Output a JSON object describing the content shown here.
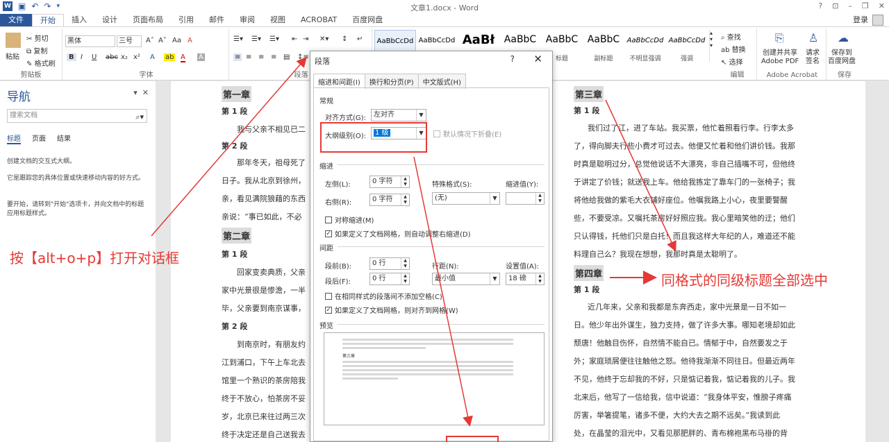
{
  "window": {
    "title": "文章1.docx - Word",
    "controls": [
      "?",
      "⊡",
      "–",
      "❐",
      "✕"
    ]
  },
  "tabs": [
    "文件",
    "开始",
    "插入",
    "设计",
    "页面布局",
    "引用",
    "邮件",
    "审阅",
    "视图",
    "ACROBAT",
    "百度网盘"
  ],
  "login": "登录",
  "ribbon": {
    "clipboard": {
      "paste": "粘贴",
      "cut": "剪切",
      "copy": "复制",
      "format_painter": "格式刷",
      "label": "剪贴板"
    },
    "font": {
      "name": "黑体",
      "size": "三号",
      "label": "字体",
      "bold": "B",
      "italic": "I",
      "underline": "U",
      "strike": "abc",
      "sub": "x₂",
      "sup": "x²",
      "grow": "A˄",
      "shrink": "A˅",
      "case": "Aa",
      "clear": "A"
    },
    "paragraph": {
      "label": "段落"
    },
    "styles": [
      {
        "sample": "AaBbCcDd",
        "name": ""
      },
      {
        "sample": "AaBbCcDd",
        "name": ""
      },
      {
        "sample": "AaBł",
        "name": ""
      },
      {
        "sample": "AaBbC",
        "name": "标题"
      },
      {
        "sample": "AaBbC",
        "name": "标题"
      },
      {
        "sample": "AaBbC",
        "name": "副标题"
      },
      {
        "sample": "AaBbCcDd",
        "name": "不明显强调"
      },
      {
        "sample": "AaBbCcDd",
        "name": "强调"
      }
    ],
    "editing": {
      "find": "查找",
      "replace": "替换",
      "select": "选择",
      "label": "编辑"
    },
    "acrobat": {
      "create_share": "创建并共享\nAdobe PDF",
      "request_sign": "请求\n签名",
      "label": "Adobe Acrobat"
    },
    "baidu": {
      "save": "保存到\n百度网盘",
      "label": "保存"
    }
  },
  "nav": {
    "title": "导航",
    "search_placeholder": "搜索文档",
    "tabs": [
      "标题",
      "页面",
      "结果"
    ],
    "text1": "创建文档的交互式大纲。",
    "text2": "它是跟踪您的具体位置或快速移动内容的好方式。",
    "text3": "要开始，请转到\"开始\"选项卡，并向文档中的标题应用标题样式。"
  },
  "doc_left": {
    "ch1": "第一章",
    "seg1": "第 1 段",
    "p1": "我与父亲不相见已二",
    "seg2": "第 2 段",
    "p2a": "那年冬天，祖母死了",
    "p2b": "日子。我从北京到徐州，",
    "p2c": "亲，看见满院狼藉的东西",
    "p2d": "亲说：“事已如此，不必",
    "ch2": "第二章",
    "seg3": "第 1 段",
    "p3a": "回家变卖典质，父亲",
    "p3b": "家中光景很是惨澹，一半",
    "p3c": "毕，父亲要到南京谋事，",
    "seg4": "第 2 段",
    "p4a": "到南京时，有朋友约",
    "p4b": "江到浦口，下午上车北去",
    "p4c": "馆里一个熟识的茶房陪我",
    "p4d": "终于不放心，怕茶房不妥",
    "p4e": "岁，北京已来往过两三次",
    "p4f": "终于决定还是自己送我去"
  },
  "doc_right": {
    "ch3": "第三章",
    "seg1": "第 1 段",
    "lines": [
      "我们过了江，进了车站。我买票，他忙着照看行李。行李太多",
      "了，得向脚夫行些小费才可过去。他便又忙着和他们讲价钱。我那",
      "时真是聪明过分，总觉他说话不大漂亮，非自己插嘴不可，但他终",
      "于讲定了价钱；就送我上车。他给我拣定了靠车门的一张椅子；我",
      "将他给我做的紫毛大衣铺好座位。他嘱我路上小心，夜里要警醒",
      "些，不要受凉。又嘱托茶房好好照应我。我心里暗笑他的迂；他们",
      "只认得钱，托他们只是白托！而且我这样大年纪的人，难道还不能",
      "料理自己么？我现在想想，我那时真是太聪明了。"
    ],
    "ch4": "第四章",
    "seg2": "第 1 段",
    "lines2": [
      "近几年来，父亲和我都是东奔西走，家中光景是一日不如一",
      "日。他少年出外谋生，独力支持，做了许多大事。哪知老境却如此",
      "颓唐！他触目伤怀，自然情不能自已。情郁于中，自然要发之于",
      "外；家庭琐屑便往往触他之怒。他待我渐渐不同往日。但最近两年",
      "不见，他终于忘却我的不好，只是惦记着我，惦记着我的儿子。我",
      "北来后，他写了一信给我，信中说道：“我身体平安，惟膀子疼痛",
      "厉害，举箸提笔，诸多不便，大约大去之期不远矣。”我读到此",
      "处，在晶莹的泪光中，又看见那肥胖的、青布棉袍黑布马褂的背"
    ]
  },
  "dialog": {
    "title": "段落",
    "help": "?",
    "close": "✕",
    "tabs": [
      "缩进和间距(I)",
      "换行和分页(P)",
      "中文版式(H)"
    ],
    "general": "常规",
    "align_label": "对齐方式(G):",
    "align_value": "左对齐",
    "outline_label": "大纲级别(O):",
    "outline_value": "1 级",
    "collapse_label": "默认情况下折叠(E)",
    "indent": "缩进",
    "left_label": "左侧(L):",
    "left_value": "0 字符",
    "right_label": "右侧(R):",
    "right_value": "0 字符",
    "special_label": "特殊格式(S):",
    "special_value": "(无)",
    "indent_value_label": "缩进值(Y):",
    "mirror_label": "对称缩进(M)",
    "auto_indent_label": "如果定义了文档网格，则自动调整右缩进(D)",
    "spacing": "间距",
    "before_label": "段前(B):",
    "before_value": "0 行",
    "after_label": "段后(F):",
    "after_value": "0 行",
    "line_label": "行距(N):",
    "line_value": "最小值",
    "setting_label": "设置值(A):",
    "setting_value": "18 磅",
    "no_space_label": "在相同样式的段落间不添加空格(C)",
    "snap_grid_label": "如果定义了文档网格，则对齐到网格(W)",
    "preview": "预览",
    "preview_heading": "第三章"
  },
  "annotations": {
    "left": "按【alt+o+p】打开对话框",
    "right": "同格式的同级标题全部选中"
  },
  "colors": {
    "accent": "#2b579a",
    "annotation": "#e53935",
    "highlight": "#0078d7"
  }
}
